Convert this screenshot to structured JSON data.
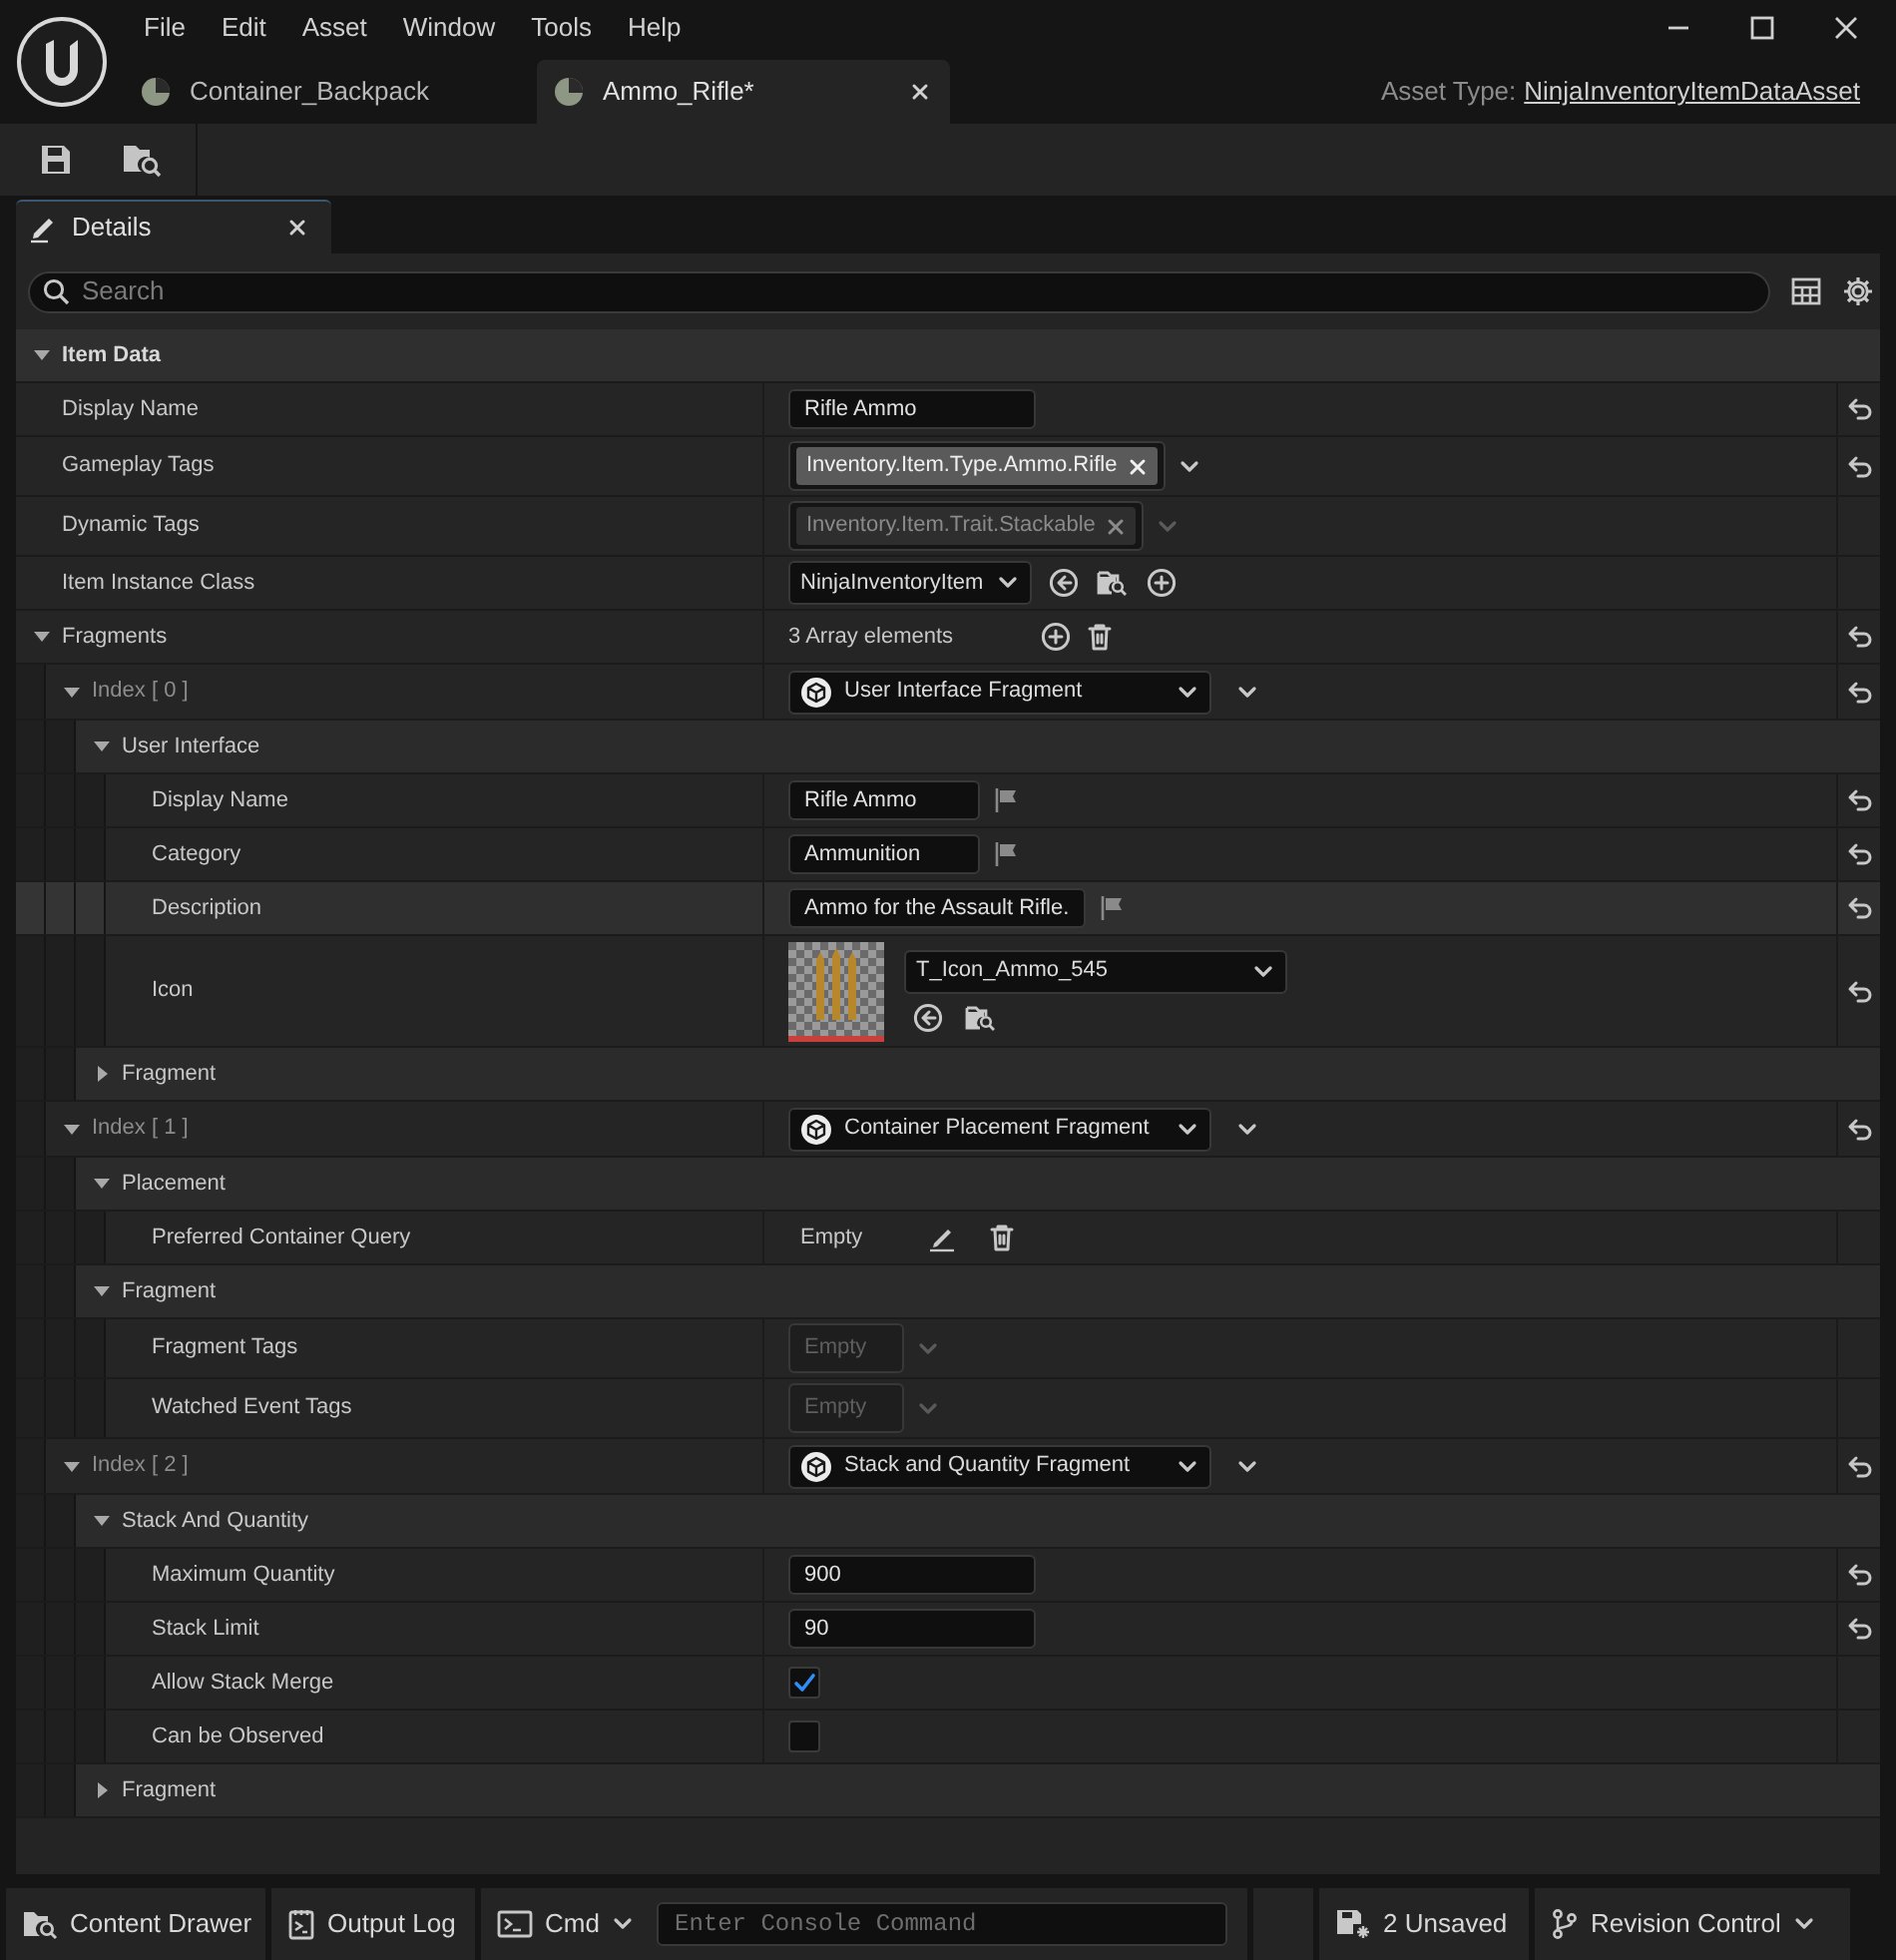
{
  "window": {
    "menu": [
      "File",
      "Edit",
      "Asset",
      "Window",
      "Tools",
      "Help"
    ],
    "tabs": [
      {
        "label": "Container_Backpack",
        "selected": false
      },
      {
        "label": "Ammo_Rifle*",
        "selected": true
      }
    ],
    "asset_type_label": "Asset Type:",
    "asset_type": "NinjaInventoryItemDataAsset"
  },
  "details": {
    "tab": "Details",
    "search": {
      "placeholder": "Search"
    },
    "rows": [
      {
        "kind": "category",
        "label": "Item Data",
        "expanded": true,
        "children": [
          {
            "kind": "text",
            "label": "Display Name",
            "value": "Rifle Ammo",
            "reset": true
          },
          {
            "kind": "tags",
            "label": "Gameplay Tags",
            "tags": [
              "Inventory.Item.Type.Ammo.Rifle"
            ],
            "disabled": false,
            "reset": true
          },
          {
            "kind": "tags",
            "label": "Dynamic Tags",
            "tags": [
              "Inventory.Item.Trait.Stackable"
            ],
            "disabled": true,
            "reset": false
          },
          {
            "kind": "class",
            "label": "Item Instance Class",
            "value": "NinjaInventoryItem",
            "reset": false
          },
          {
            "kind": "array",
            "label": "Fragments",
            "value": "3 Array elements",
            "expanded": true,
            "reset": true,
            "children": [
              {
                "kind": "element",
                "label": "Index [ 0 ]",
                "value": "User Interface Fragment",
                "expanded": true,
                "reset": true,
                "children": [
                  {
                    "kind": "group",
                    "label": "User Interface",
                    "expanded": true,
                    "children": [
                      {
                        "kind": "localized_text",
                        "label": "Display Name",
                        "value": "Rifle Ammo",
                        "highlighted": false,
                        "reset": true
                      },
                      {
                        "kind": "localized_text",
                        "label": "Category",
                        "value": "Ammunition",
                        "highlighted": false,
                        "reset": true
                      },
                      {
                        "kind": "localized_text",
                        "label": "Description",
                        "value": "Ammo for the Assault Rifle.",
                        "highlighted": true,
                        "reset": true
                      },
                      {
                        "kind": "texture",
                        "label": "Icon",
                        "value": "T_Icon_Ammo_545",
                        "highlighted": false,
                        "reset": true
                      }
                    ]
                  },
                  {
                    "kind": "group",
                    "label": "Fragment",
                    "expanded": false
                  }
                ]
              },
              {
                "kind": "element",
                "label": "Index [ 1 ]",
                "value": "Container Placement Fragment",
                "expanded": true,
                "reset": true,
                "children": [
                  {
                    "kind": "group",
                    "label": "Placement",
                    "expanded": true,
                    "children": [
                      {
                        "kind": "query",
                        "label": "Preferred Container Query",
                        "value": "Empty",
                        "reset": false
                      }
                    ]
                  },
                  {
                    "kind": "group",
                    "label": "Fragment",
                    "expanded": true,
                    "children": [
                      {
                        "kind": "empty_tags",
                        "label": "Fragment Tags",
                        "value": "Empty",
                        "reset": false
                      },
                      {
                        "kind": "empty_tags",
                        "label": "Watched Event Tags",
                        "value": "Empty",
                        "reset": false
                      }
                    ]
                  }
                ]
              },
              {
                "kind": "element",
                "label": "Index [ 2 ]",
                "value": "Stack and Quantity Fragment",
                "expanded": true,
                "reset": true,
                "children": [
                  {
                    "kind": "group",
                    "label": "Stack And Quantity",
                    "expanded": true,
                    "children": [
                      {
                        "kind": "text",
                        "label": "Maximum Quantity",
                        "value": "900",
                        "reset": true
                      },
                      {
                        "kind": "text",
                        "label": "Stack Limit",
                        "value": "90",
                        "reset": true
                      },
                      {
                        "kind": "checkbox",
                        "label": "Allow Stack Merge",
                        "checked": true,
                        "reset": false
                      },
                      {
                        "kind": "checkbox",
                        "label": "Can be Observed",
                        "checked": false,
                        "reset": false
                      }
                    ]
                  },
                  {
                    "kind": "group",
                    "label": "Fragment",
                    "expanded": false
                  }
                ]
              }
            ]
          }
        ]
      }
    ]
  },
  "status_bar": {
    "content_drawer": "Content Drawer",
    "output_log": "Output Log",
    "cmd": "Cmd",
    "console": {
      "placeholder": "Enter Console Command"
    },
    "unsaved": "2 Unsaved",
    "revision_control": "Revision Control"
  }
}
